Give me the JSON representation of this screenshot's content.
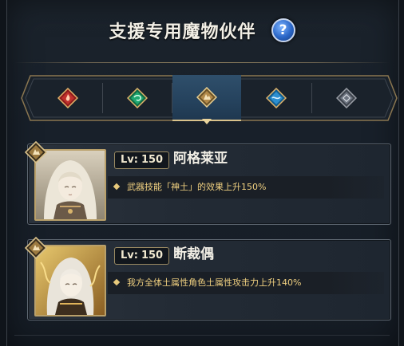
{
  "header": {
    "title": "支援专用魔物伙伴",
    "help_label": "?"
  },
  "tabs": [
    {
      "element": "fire",
      "icon": "fire-gem-icon",
      "color": "#c0302c",
      "active": false
    },
    {
      "element": "wind",
      "icon": "wind-gem-icon",
      "color": "#1fa870",
      "active": false
    },
    {
      "element": "earth",
      "icon": "earth-gem-icon",
      "color": "#b28a4a",
      "active": true
    },
    {
      "element": "water",
      "icon": "water-gem-icon",
      "color": "#2c8fd0",
      "active": false
    },
    {
      "element": "neutral",
      "icon": "neutral-gem-icon",
      "color": "#6d7480",
      "active": false
    }
  ],
  "partners": [
    {
      "level_label": "Lv:",
      "level": "150",
      "name": "阿格莱亚",
      "effect": "武器技能「神土」的效果上升150%",
      "element": "earth"
    },
    {
      "level_label": "Lv:",
      "level": "150",
      "name": "断裁偶",
      "effect": "我方全体土属性角色土属性攻击力上升140%",
      "element": "earth"
    }
  ],
  "colors": {
    "accent_gold": "#d9c28b",
    "effect_text": "#f0d080",
    "active_tab": "#2f4f6b"
  }
}
